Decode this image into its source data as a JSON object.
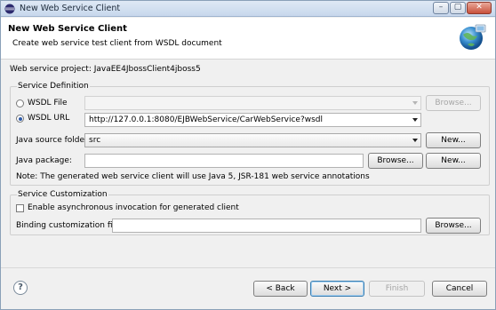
{
  "window": {
    "title": "New Web Service Client"
  },
  "header": {
    "title": "New Web Service Client",
    "description": "Create web service test client from WSDL document"
  },
  "project": {
    "label": "Web service project: JavaEE4JbossClient4jboss5"
  },
  "service_definition": {
    "group_title": "Service Definition",
    "wsdl_file": {
      "label": "WSDL File",
      "selected": false,
      "value": "",
      "browse_label": "Browse...",
      "browse_enabled": false
    },
    "wsdl_url": {
      "label": "WSDL URL",
      "selected": true,
      "value": "http://127.0.0.1:8080/EJBWebService/CarWebService?wsdl"
    },
    "source_folder": {
      "label": "Java source folder:",
      "value": "src",
      "new_label": "New..."
    },
    "java_package": {
      "label": "Java package:",
      "value": "",
      "browse_label": "Browse...",
      "new_label": "New..."
    },
    "note": "Note: The generated web service client will use Java 5, JSR-181 web service annotations"
  },
  "service_customization": {
    "group_title": "Service Customization",
    "async_label": "Enable asynchronous invocation for generated client",
    "async_checked": false,
    "binding_label": "Binding customization file:",
    "binding_value": "",
    "browse_label": "Browse..."
  },
  "footer": {
    "help_glyph": "?",
    "back_label": "< Back",
    "next_label": "Next >",
    "finish_label": "Finish",
    "finish_enabled": false,
    "cancel_label": "Cancel"
  },
  "colors": {
    "title_bar": "#c7d7ec",
    "close_button": "#c8503b",
    "default_button_border": "#3c7fb1"
  }
}
